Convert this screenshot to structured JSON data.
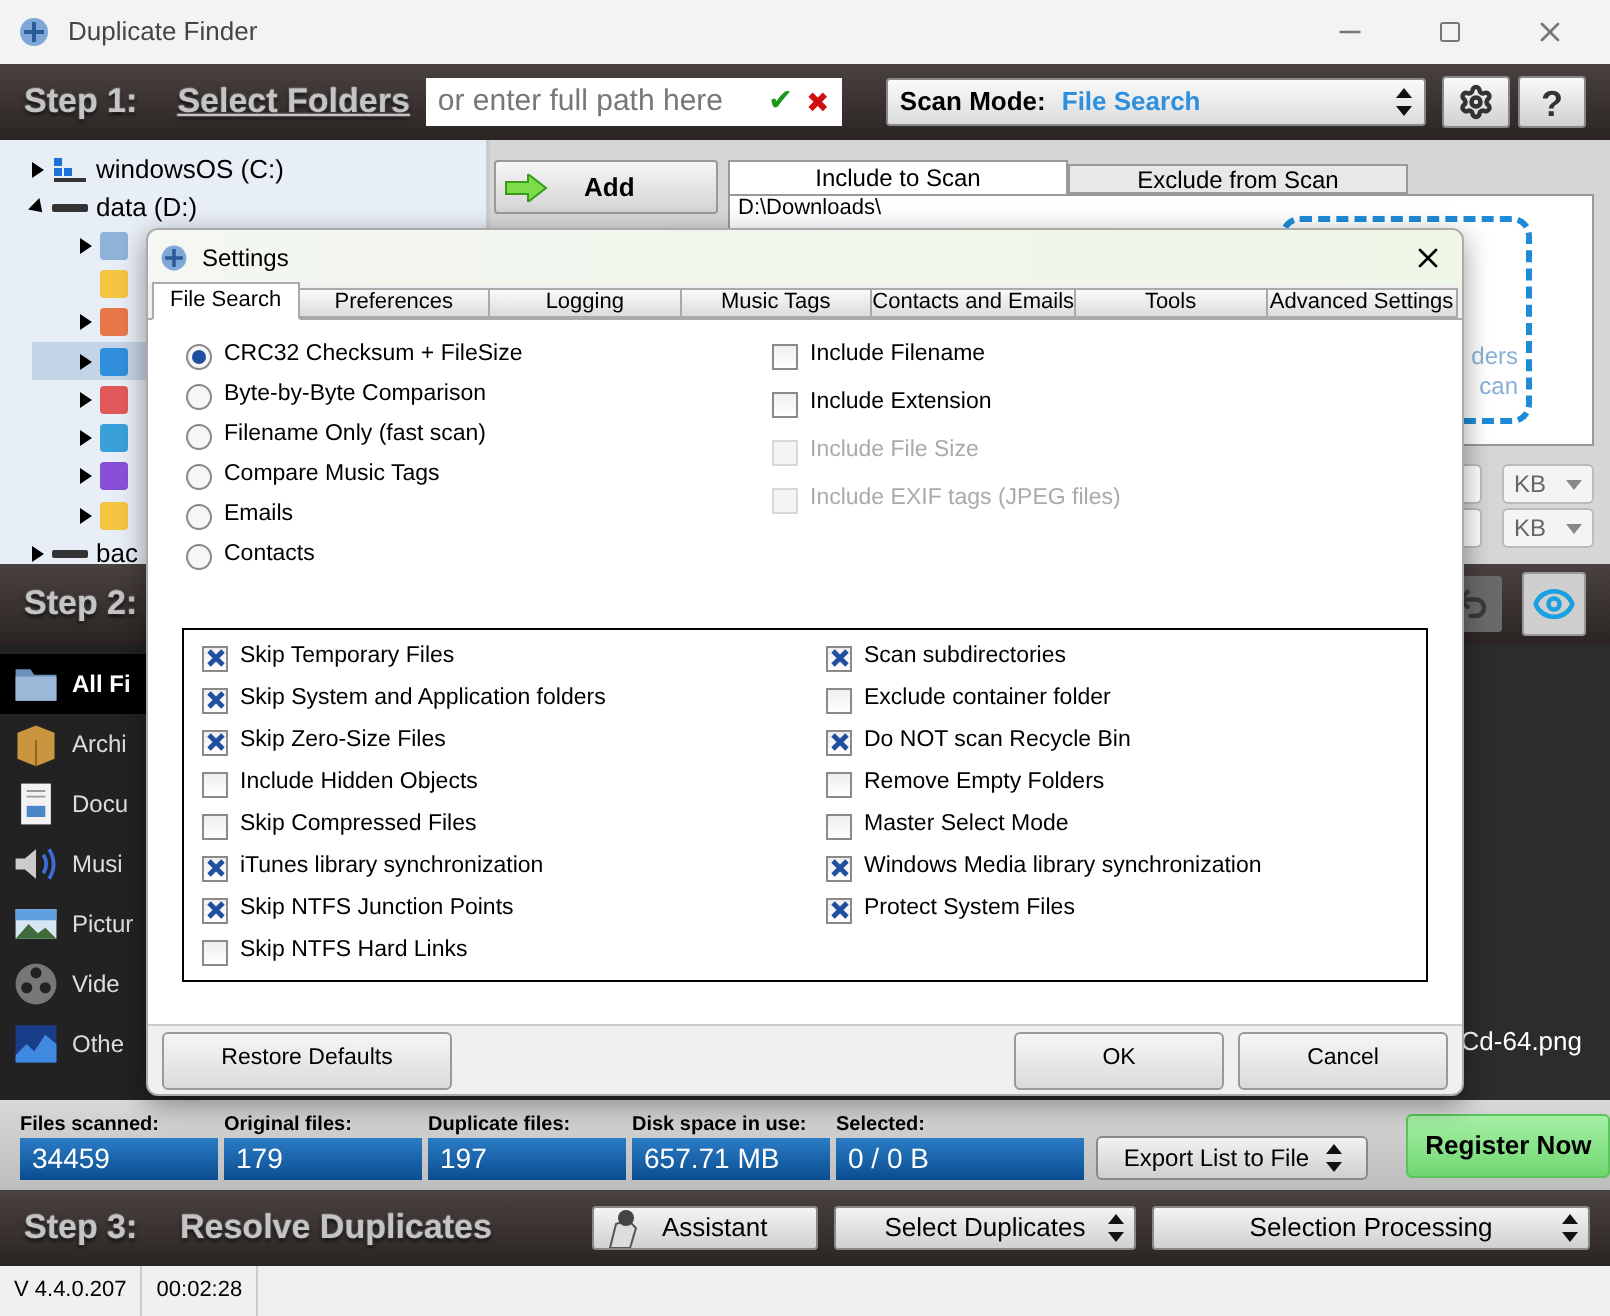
{
  "window": {
    "title": "Duplicate Finder"
  },
  "step1": {
    "step_label": "Step 1:",
    "link": "Select Folders",
    "path_field": {
      "placeholder": "or enter full path here"
    },
    "confirm": "✔",
    "clear": "✖",
    "scan_mode": {
      "label": "Scan Mode:",
      "value": "File Search"
    },
    "help": "?"
  },
  "folder_tree": [
    {
      "label": "windowsOS (C:)",
      "kind": "os_drive",
      "expanded": false
    },
    {
      "label": "data (D:)",
      "kind": "drive",
      "expanded": true,
      "children": [
        {
          "color": "#8fb3d9",
          "expandable": true,
          "selected": false
        },
        {
          "color": "#f5c542",
          "expandable": false,
          "selected": false
        },
        {
          "color": "#e8774a",
          "expandable": true,
          "selected": false
        },
        {
          "color": "#2f8fdc",
          "expandable": true,
          "selected": true
        },
        {
          "color": "#e05a5a",
          "expandable": true,
          "selected": false
        },
        {
          "color": "#3aa0d8",
          "expandable": true,
          "selected": false
        },
        {
          "color": "#8a4fd8",
          "expandable": true,
          "selected": false
        },
        {
          "color": "#f5c542",
          "expandable": true,
          "selected": false
        }
      ]
    },
    {
      "label": "bac",
      "kind": "drive",
      "expanded": false
    }
  ],
  "add_button": "Add",
  "scan_tabs": [
    {
      "label": "Include to Scan",
      "selected": true
    },
    {
      "label": "Exclude from Scan",
      "selected": false
    }
  ],
  "include_list": [
    "D:\\Downloads\\"
  ],
  "drop_hint": [
    "ders",
    "can"
  ],
  "size_filters": [
    {
      "unit": "KB"
    },
    {
      "unit": "KB"
    }
  ],
  "step2": {
    "step_label": "Step 2:"
  },
  "categories": [
    {
      "label": "All Fi",
      "kind": "all",
      "selected": true
    },
    {
      "label": "Archi",
      "kind": "archive",
      "selected": false
    },
    {
      "label": "Docu",
      "kind": "document",
      "selected": false
    },
    {
      "label": "Musi",
      "kind": "music",
      "selected": false
    },
    {
      "label": "Pictur",
      "kind": "picture",
      "selected": false
    },
    {
      "label": "Vide",
      "kind": "video",
      "selected": false
    },
    {
      "label": "Othe",
      "kind": "other",
      "selected": false
    }
  ],
  "results": [
    "Cd-64.png"
  ],
  "stats": [
    {
      "label": "Files scanned:",
      "value": "34459"
    },
    {
      "label": "Original files:",
      "value": "179"
    },
    {
      "label": "Duplicate files:",
      "value": "197"
    },
    {
      "label": "Disk space in use:",
      "value": "657.71 MB"
    },
    {
      "label": "Selected:",
      "value": "0 / 0 B"
    }
  ],
  "export_button": "Export List to File",
  "register_button": "Register Now",
  "step3": {
    "step_label": "Step 3:",
    "title": "Resolve Duplicates",
    "buttons": [
      {
        "label": "Assistant",
        "kind": "assistant"
      },
      {
        "label": "Select Duplicates",
        "kind": "spinner"
      },
      {
        "label": "Selection Processing",
        "kind": "spinner"
      }
    ]
  },
  "status_bar": [
    "V 4.4.0.207",
    "00:02:28"
  ],
  "settings_dialog": {
    "title": "Settings",
    "tabs": [
      {
        "label": "File Search",
        "selected": true
      },
      {
        "label": "Preferences",
        "selected": false
      },
      {
        "label": "Logging",
        "selected": false
      },
      {
        "label": "Music Tags",
        "selected": false
      },
      {
        "label": "Contacts and Emails",
        "selected": false
      },
      {
        "label": "Tools",
        "selected": false
      },
      {
        "label": "Advanced Settings",
        "selected": false
      }
    ],
    "methods": [
      {
        "label": "CRC32 Checksum + FileSize",
        "selected": true
      },
      {
        "label": "Byte-by-Byte Comparison",
        "selected": false
      },
      {
        "label": "Filename Only (fast scan)",
        "selected": false
      },
      {
        "label": "Compare Music Tags",
        "selected": false
      },
      {
        "label": "Emails",
        "selected": false
      },
      {
        "label": "Contacts",
        "selected": false
      }
    ],
    "match_options": [
      {
        "label": "Include Filename",
        "checked": false,
        "disabled": false
      },
      {
        "label": "Include Extension",
        "checked": false,
        "disabled": false
      },
      {
        "label": "Include File Size",
        "checked": false,
        "disabled": true
      },
      {
        "label": "Include EXIF tags (JPEG files)",
        "checked": false,
        "disabled": true
      }
    ],
    "options_left": [
      {
        "label": "Skip Temporary Files",
        "checked": true
      },
      {
        "label": "Skip System and Application folders",
        "checked": true
      },
      {
        "label": "Skip Zero-Size Files",
        "checked": true
      },
      {
        "label": "Include Hidden Objects",
        "checked": false
      },
      {
        "label": "Skip Compressed Files",
        "checked": false
      },
      {
        "label": "iTunes library synchronization",
        "checked": true
      },
      {
        "label": "Skip NTFS Junction Points",
        "checked": true
      },
      {
        "label": "Skip NTFS Hard Links",
        "checked": false
      }
    ],
    "options_right": [
      {
        "label": "Scan subdirectories",
        "checked": true
      },
      {
        "label": "Exclude container folder",
        "checked": false
      },
      {
        "label": "Do NOT scan Recycle Bin",
        "checked": true
      },
      {
        "label": "Remove Empty Folders",
        "checked": false
      },
      {
        "label": "Master Select Mode",
        "checked": false
      },
      {
        "label": "Windows Media library synchronization",
        "checked": true
      },
      {
        "label": "Protect System Files",
        "checked": true
      }
    ],
    "buttons": [
      "Restore Defaults",
      "OK",
      "Cancel"
    ]
  }
}
